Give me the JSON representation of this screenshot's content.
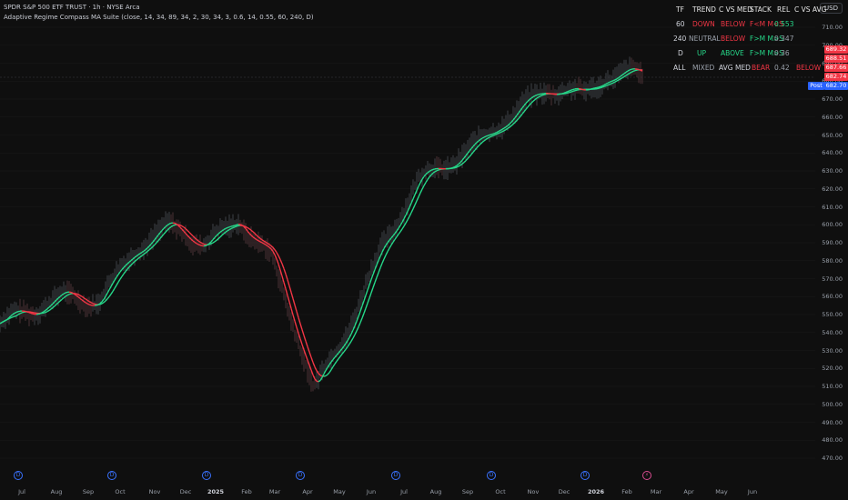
{
  "header": {
    "title": "SPDR S&P 500 ETF TRUST · 1h · NYSE Arca",
    "indicator": "Adaptive Regime Compass MA Suite (close, 14, 34, 89, 34, 2, 30, 34, 3, 0.6, 14, 0.55, 60, 240, D)"
  },
  "currency": "USD",
  "table": {
    "headers": [
      "TF",
      "TREND",
      "C VS MED",
      "STACK",
      "REL",
      "C VS AVG"
    ],
    "rows": [
      {
        "tf": "60",
        "trend": "DOWN",
        "cvsmed": "BELOW",
        "stack": "F<M M<S",
        "rel": "0.553",
        "cvsavg": ""
      },
      {
        "tf": "240",
        "trend": "NEUTRAL",
        "cvsmed": "BELOW",
        "stack": "F>M M>S",
        "rel": "0.347",
        "cvsavg": ""
      },
      {
        "tf": "D",
        "trend": "UP",
        "cvsmed": "ABOVE",
        "stack": "F>M M>S",
        "rel": "0.36",
        "cvsavg": ""
      },
      {
        "tf": "ALL",
        "trend": "MIXED",
        "cvsmed": "AVG MED",
        "stack": "BEAR",
        "rel": "0.42",
        "cvsavg": "BELOW"
      }
    ]
  },
  "colors": {
    "up": "#26d98a",
    "down": "#f23645",
    "neutral": "#9aa0aa",
    "accent": "#2962ff"
  },
  "yaxis": {
    "ticks": [
      "710.00",
      "700.00",
      "690.00",
      "680.00",
      "670.00",
      "660.00",
      "650.00",
      "640.00",
      "630.00",
      "620.00",
      "610.00",
      "600.00",
      "590.00",
      "580.00",
      "570.00",
      "560.00",
      "550.00",
      "540.00",
      "530.00",
      "520.00",
      "510.00",
      "500.00",
      "490.00",
      "480.00",
      "470.00"
    ]
  },
  "xaxis": {
    "ticks": [
      "Jul",
      "Aug",
      "Sep",
      "Oct",
      "Nov",
      "Dec",
      "2025",
      "Feb",
      "Mar",
      "Apr",
      "May",
      "Jun",
      "Jul",
      "Aug",
      "Sep",
      "Oct",
      "Nov",
      "Dec",
      "2026",
      "Feb",
      "Mar",
      "Apr",
      "May",
      "Jun"
    ]
  },
  "price_tags": [
    {
      "value": "689.32",
      "color": "#f23645"
    },
    {
      "value": "688.51",
      "color": "#f23645"
    },
    {
      "value": "687.66",
      "color": "#f23645"
    },
    {
      "value": "682.74",
      "color": "#f23645"
    },
    {
      "value": "682.70",
      "color": "#2962ff"
    }
  ],
  "post_label": "Post",
  "events": [
    {
      "icon": "dividend-icon",
      "glyph": "D"
    },
    {
      "icon": "dividend-icon",
      "glyph": "D"
    },
    {
      "icon": "dividend-icon",
      "glyph": "D"
    },
    {
      "icon": "dividend-icon",
      "glyph": "D"
    },
    {
      "icon": "dividend-icon",
      "glyph": "D"
    },
    {
      "icon": "dividend-icon",
      "glyph": "D"
    },
    {
      "icon": "earnings-flash-icon",
      "glyph": "⚡"
    }
  ],
  "chart_data": {
    "type": "line",
    "ylim": [
      465,
      715
    ],
    "x": [
      "Jul",
      "Aug",
      "Sep",
      "Oct",
      "Nov",
      "Dec",
      "2025",
      "Feb",
      "Mar",
      "Apr",
      "May",
      "Jun",
      "Jul",
      "Aug",
      "Sep",
      "Oct",
      "Nov",
      "Dec",
      "2026",
      "Feb"
    ],
    "price": [
      545,
      548,
      560,
      562,
      585,
      595,
      590,
      607,
      580,
      505,
      545,
      590,
      620,
      635,
      660,
      672,
      670,
      685,
      688,
      687
    ]
  }
}
